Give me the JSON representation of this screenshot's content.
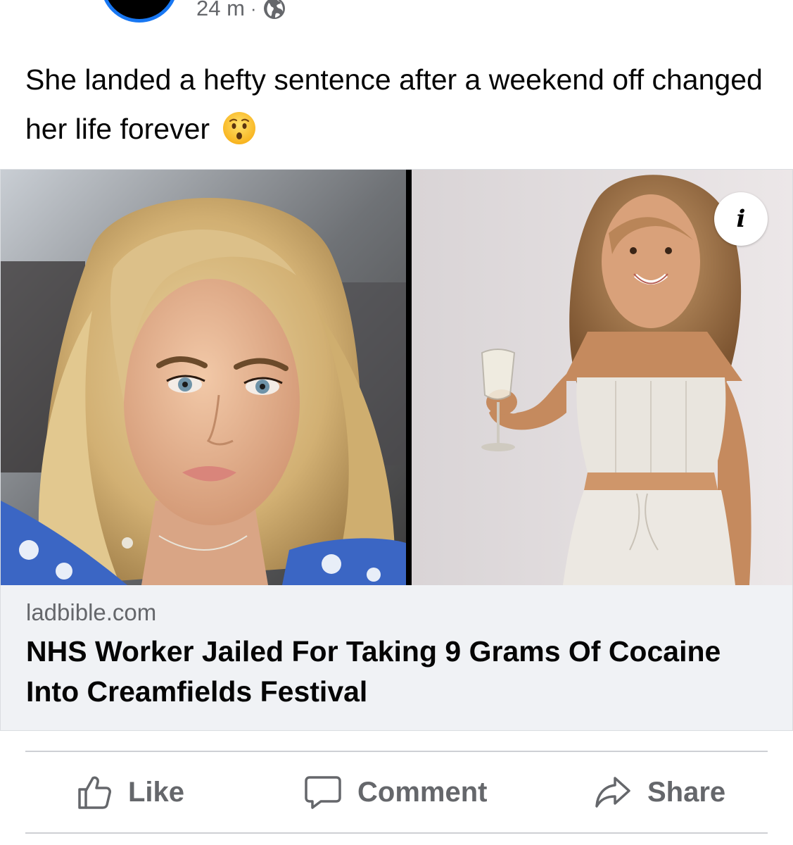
{
  "post": {
    "time": "24 m",
    "separator": "·",
    "audience_icon": "globe-icon",
    "caption": "She landed a hefty sentence after a weekend off changed her life forever",
    "caption_emoji": "hushed-face-emoji"
  },
  "link_preview": {
    "info_label": "i",
    "domain": "ladbible.com",
    "title": "NHS Worker Jailed For Taking 9 Grams Of Cocaine Into Creamfields Festival"
  },
  "actions": {
    "like_label": "Like",
    "comment_label": "Comment",
    "share_label": "Share"
  },
  "colors": {
    "brand_blue": "#1877f2",
    "secondary_text": "#65676b",
    "card_background": "#f0f2f5",
    "divider": "#ced0d4"
  }
}
